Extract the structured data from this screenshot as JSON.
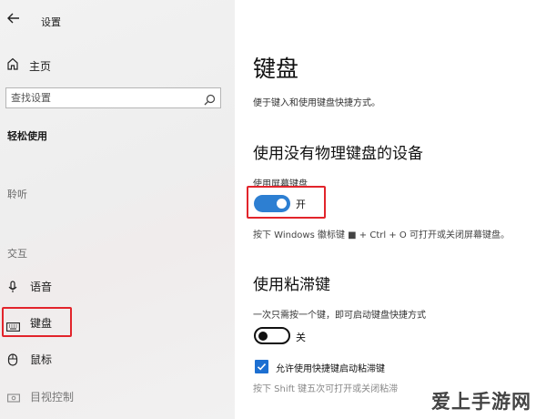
{
  "window": {
    "title": "设置"
  },
  "sidebar": {
    "home_label": "主页",
    "search": {
      "placeholder": "查找设置"
    },
    "section_title": "轻松使用",
    "groups": {
      "hearing": "聆听",
      "interaction": "交互"
    },
    "items": [
      {
        "label": "语音",
        "icon": "microphone-icon"
      },
      {
        "label": "键盘",
        "icon": "keyboard-icon",
        "selected": true
      },
      {
        "label": "鼠标",
        "icon": "mouse-icon"
      },
      {
        "label": "目视控制",
        "icon": "eye-control-icon"
      }
    ]
  },
  "main": {
    "title": "键盘",
    "description": "便于键入和使用键盘快捷方式。",
    "onscreen_keyboard": {
      "heading": "使用没有物理键盘的设备",
      "setting_label": "使用屏幕键盘",
      "toggle_state": "开",
      "toggle_on": true,
      "hint": "按下 Windows 徽标键 ■ + Ctrl + O 可打开或关闭屏幕键盘。"
    },
    "sticky_keys": {
      "heading": "使用粘滞键",
      "setting_label": "一次只需按一个键，即可启动键盘快捷方式",
      "toggle_state": "关",
      "toggle_on": false,
      "checkbox_label": "允许使用快捷键启动粘滞键",
      "checkbox_checked": true,
      "hint": "按下 Shift 键五次可打开或关闭粘滞"
    }
  },
  "watermark": "爱上手游网",
  "colors": {
    "accent": "#2d7fd2",
    "checkbox": "#1d6fd1",
    "highlight": "#e2242b"
  }
}
